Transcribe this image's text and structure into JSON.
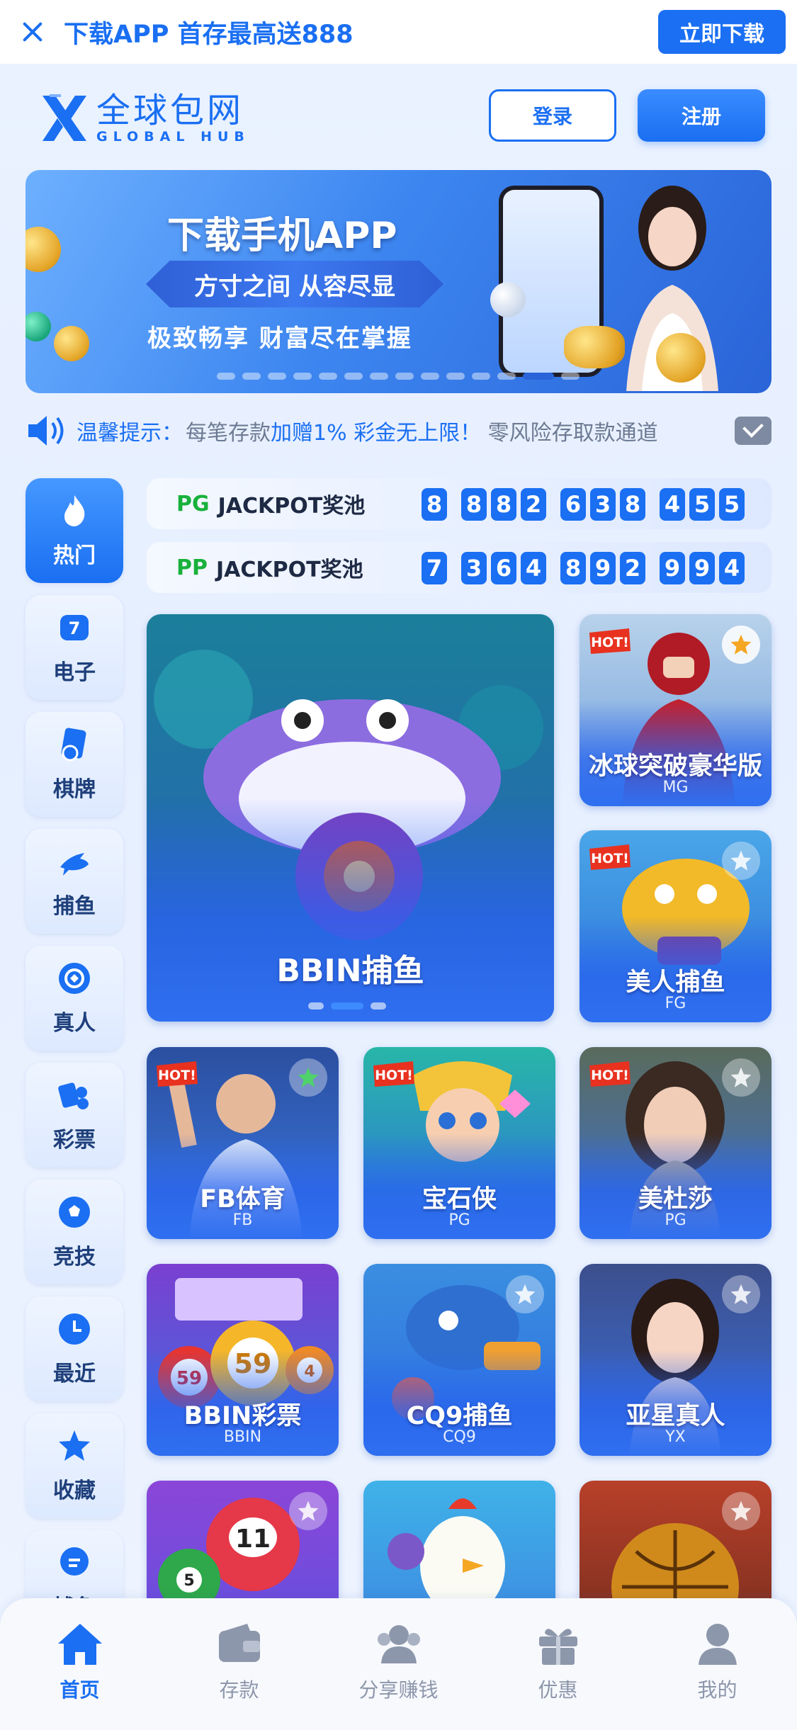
{
  "topbar": {
    "promo": "下载APP 首存最高送888",
    "download_label": "立即下载"
  },
  "header": {
    "logo_cn": "全球包网",
    "logo_en": "GLOBAL HUB",
    "login_label": "登录",
    "register_label": "注册"
  },
  "banner": {
    "title": "下载手机APP",
    "ribbon": "方寸之间 从容尽显",
    "subtitle": "极致畅享 财富尽在掌握"
  },
  "notice": {
    "label": "温馨提示：",
    "text_1": "每笔存款",
    "highlight_1": "加赠1% 彩金无上限！",
    "text_2": " 零风险存取款通道"
  },
  "sidebar": {
    "items": [
      {
        "label": "热门",
        "icon": "flame-icon"
      },
      {
        "label": "电子",
        "icon": "slot-icon"
      },
      {
        "label": "棋牌",
        "icon": "cards-icon"
      },
      {
        "label": "捕鱼",
        "icon": "shark-icon"
      },
      {
        "label": "真人",
        "icon": "chip-icon"
      },
      {
        "label": "彩票",
        "icon": "lottery-icon"
      },
      {
        "label": "竞技",
        "icon": "soccer-icon"
      },
      {
        "label": "最近",
        "icon": "clock-icon"
      },
      {
        "label": "收藏",
        "icon": "star-icon"
      },
      {
        "label": "捕鱼",
        "icon": "chat-icon"
      }
    ]
  },
  "jackpots": [
    {
      "provider": "PG",
      "title": "JACKPOT奖池",
      "groups": [
        "8",
        "882",
        "638",
        "455"
      ]
    },
    {
      "provider": "PP",
      "title": "JACKPOT奖池",
      "groups": [
        "7",
        "364",
        "892",
        "994"
      ]
    }
  ],
  "games": {
    "featured": {
      "name": "BBIN捕鱼"
    },
    "g1": {
      "name": "冰球突破豪华版",
      "provider": "MG",
      "hot": "HOT!"
    },
    "g2": {
      "name": "美人捕鱼",
      "provider": "FG",
      "hot": "HOT!"
    },
    "g3": {
      "name": "FB体育",
      "provider": "FB",
      "hot": "HOT!"
    },
    "g4": {
      "name": "宝石侠",
      "provider": "PG",
      "hot": "HOT!"
    },
    "g5": {
      "name": "美杜莎",
      "provider": "PG",
      "hot": "HOT!"
    },
    "g6": {
      "name": "BBIN彩票",
      "provider": "BBIN",
      "ball_59": "59",
      "ball_4": "4",
      "ball_59b": "59"
    },
    "g7": {
      "name": "CQ9捕鱼",
      "provider": "CQ9"
    },
    "g8": {
      "name": "亚星真人",
      "provider": "YX"
    },
    "g9": {
      "ball_11": "11",
      "ball_5": "5"
    }
  },
  "bottom_nav": [
    {
      "label": "首页",
      "icon": "home-icon"
    },
    {
      "label": "存款",
      "icon": "wallet-icon"
    },
    {
      "label": "分享赚钱",
      "icon": "users-icon"
    },
    {
      "label": "优惠",
      "icon": "gift-icon"
    },
    {
      "label": "我的",
      "icon": "user-icon"
    }
  ],
  "colors": {
    "primary": "#1a6ff2",
    "jackpot_provider": "#18b13b",
    "page_bg": "#e6efff"
  }
}
